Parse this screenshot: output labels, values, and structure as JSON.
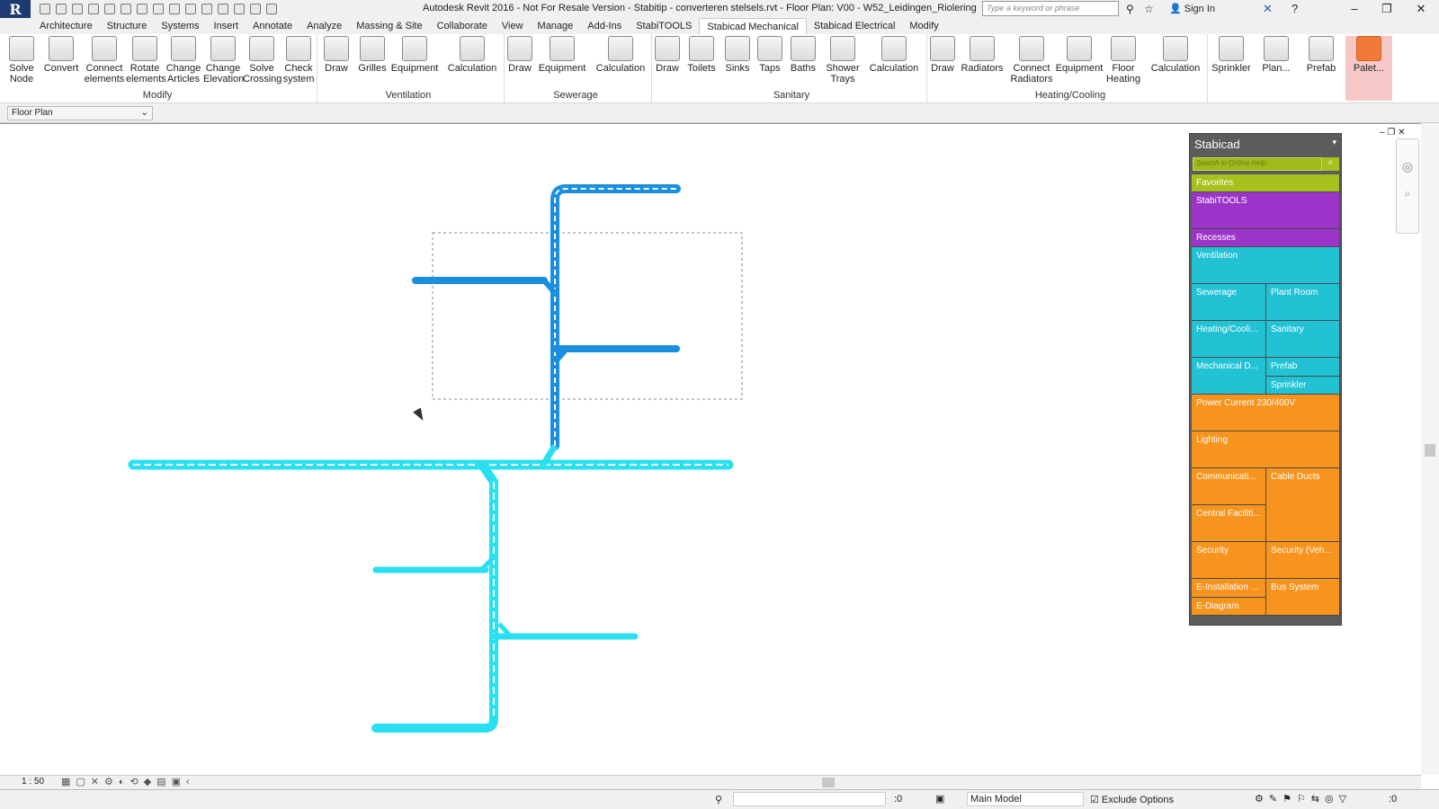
{
  "window": {
    "title": "Autodesk Revit 2016 - Not For Resale Version -   Stabitip - converteren stelsels.rvt - Floor Plan: V00 - W52_Leidingen_Riolering",
    "search_placeholder": "Type a keyword or phrase",
    "signin_label": "Sign In"
  },
  "tabs": [
    "Architecture",
    "Structure",
    "Systems",
    "Insert",
    "Annotate",
    "Analyze",
    "Massing & Site",
    "Collaborate",
    "View",
    "Manage",
    "Add-Ins",
    "StabiTOOLS",
    "Stabicad Mechanical",
    "Stabicad Electrical",
    "Modify"
  ],
  "active_tab": "Stabicad Mechanical",
  "ribbon": {
    "panels": [
      {
        "name": "Modify",
        "buttons": [
          "Solve Node",
          "Convert",
          "Connect elements",
          "Rotate elements",
          "Change Articles",
          "Change Elevation",
          "Solve Crossing",
          "Check system"
        ]
      },
      {
        "name": "Ventilation",
        "buttons": [
          "Draw",
          "Grilles",
          "Equipment",
          "Calculation"
        ]
      },
      {
        "name": "Sewerage",
        "buttons": [
          "Draw",
          "Equipment",
          "Calculation"
        ]
      },
      {
        "name": "Sanitary",
        "buttons": [
          "Draw",
          "Toilets",
          "Sinks",
          "Taps",
          "Baths",
          "Shower Trays",
          "Calculation"
        ]
      },
      {
        "name": "Heating/Cooling",
        "buttons": [
          "Draw",
          "Radiators",
          "Connect Radiators",
          "Equipment",
          "Floor Heating",
          "Calculation"
        ]
      },
      {
        "name": "",
        "buttons": [
          "Sprinkler",
          "Plan...",
          "Prefab",
          "Palet..."
        ]
      }
    ]
  },
  "properties_selector": "Floor Plan",
  "palette": {
    "title": "Stabicad",
    "search_placeholder": "Search in Online Help",
    "tiles": [
      "Favorites",
      "StabiTOOLS",
      "Recesses",
      "Ventilation",
      "Sewerage",
      "Plant Room",
      "Heating/Cooli...",
      "Sanitary",
      "Mechanical D...",
      "Prefab",
      "Sprinkler",
      "Power Current 230/400V",
      "Lighting",
      "Communicati...",
      "Cable Ducts",
      "Central Faciliti...",
      "Security",
      "Security (Veh...",
      "E-Installation ...",
      "Bus System",
      "E-Diagram"
    ],
    "colors": {
      "green": "#a5c21d",
      "purple": "#9b35c9",
      "cyan": "#21c2d4",
      "orange": "#f7941d"
    }
  },
  "view_control": {
    "scale": "1 : 50"
  },
  "status": {
    "model": "Main Model",
    "exclude_options": "Exclude Options",
    "selection_count": ":0",
    "filter_count": ":0"
  },
  "drawing_colors": {
    "pipe_light": "#29e0f0",
    "pipe_selected": "#1a8fe0"
  }
}
